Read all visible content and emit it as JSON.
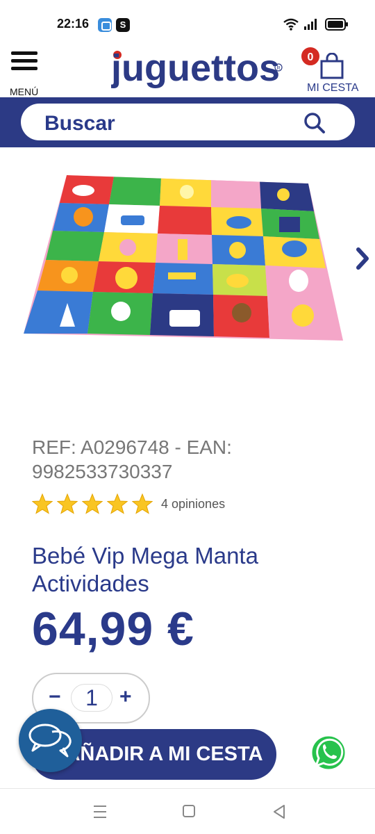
{
  "status_bar": {
    "time": "22:16",
    "app_b_glyph": "S",
    "icons": [
      "wifi-icon",
      "signal-icon",
      "battery-icon"
    ]
  },
  "header": {
    "menu_label": "MENÚ",
    "logo_text": "juguettos",
    "cart_count": "0",
    "cart_label": "MI CESTA",
    "brand_color": "#2c3a85",
    "accent_color": "#d42a22"
  },
  "search": {
    "placeholder": "Buscar"
  },
  "product": {
    "ref_text": "REF: A0296748 - EAN: 9982533730337",
    "rating_stars": 5,
    "rating_text": "4 opiniones",
    "title": "Bebé Vip Mega Manta Actividades",
    "price": "64,99 €",
    "quantity": "1",
    "qty_minus": "−",
    "qty_plus": "+",
    "add_button": "AÑADIR A MI CESTA"
  },
  "floating": {
    "chat_icon": "chat-bubbles-icon",
    "whatsapp_icon": "whatsapp-icon"
  }
}
